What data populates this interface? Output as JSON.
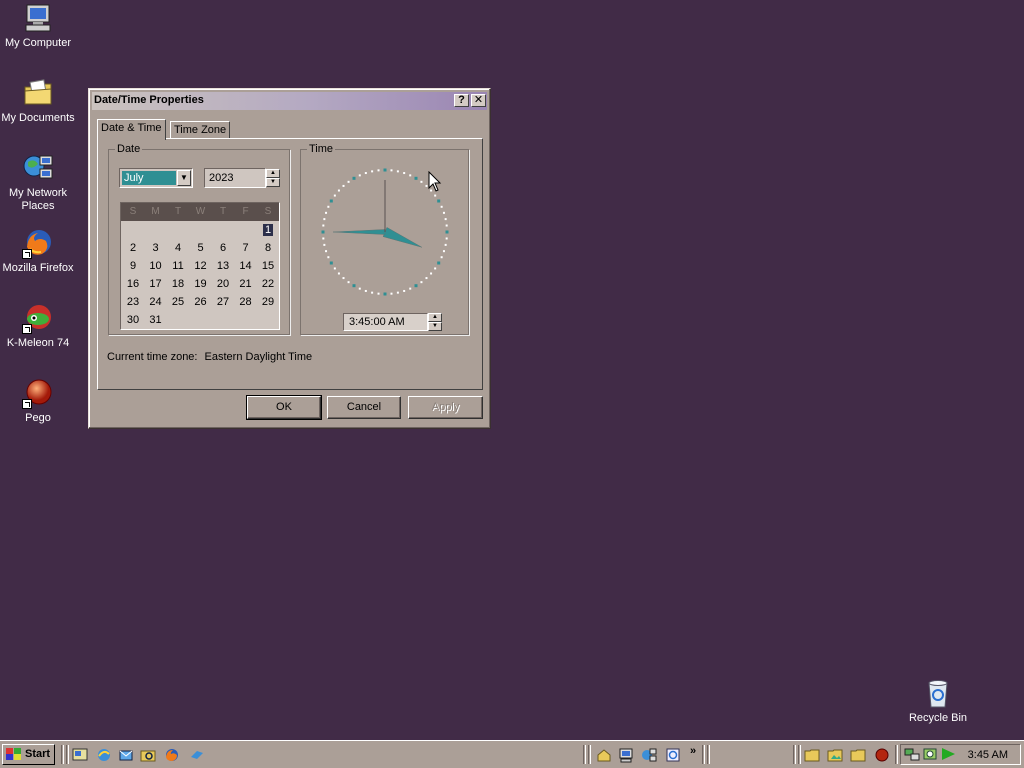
{
  "desktop": {
    "icons": [
      {
        "label": "My Computer",
        "icon": "computer-icon"
      },
      {
        "label": "My Documents",
        "icon": "folder-documents-icon"
      },
      {
        "label": "My Network Places",
        "icon": "network-places-icon"
      },
      {
        "label": "Mozilla Firefox",
        "icon": "firefox-icon"
      },
      {
        "label": "K-Meleon 74",
        "icon": "kmeleon-icon"
      },
      {
        "label": "Pego",
        "icon": "pego-icon"
      }
    ],
    "recycle_bin": {
      "label": "Recycle Bin",
      "icon": "recycle-bin-icon"
    }
  },
  "dialog": {
    "title": "Date/Time Properties",
    "help_btn": "?",
    "close_btn": "✕",
    "tabs": [
      "Date & Time",
      "Time Zone"
    ],
    "date_group": "Date",
    "month": "July",
    "year": "2023",
    "weekdays": [
      "S",
      "M",
      "T",
      "W",
      "T",
      "F",
      "S"
    ],
    "days": [
      "1",
      "2",
      "3",
      "4",
      "5",
      "6",
      "7",
      "8",
      "9",
      "10",
      "11",
      "12",
      "13",
      "14",
      "15",
      "16",
      "17",
      "18",
      "19",
      "20",
      "21",
      "22",
      "23",
      "24",
      "25",
      "26",
      "27",
      "28",
      "29",
      "30",
      "31"
    ],
    "first_weekday_index": 6,
    "selected_day": "1",
    "time_group": "Time",
    "time_value": "3:45:00 AM",
    "current_tz_label": "Current time zone:",
    "current_tz_value": "Eastern Daylight Time",
    "ok": "OK",
    "cancel": "Cancel",
    "apply": "Apply"
  },
  "clock_face": {
    "hour": 3,
    "minute": 45,
    "second": 0,
    "hand_color": "#2f8f93"
  },
  "taskbar": {
    "start": "Start",
    "quick_launch": [
      "show-desktop-icon",
      "ie-icon",
      "outlook-icon",
      "explorer-icon",
      "firefox-icon",
      "messenger-icon"
    ],
    "chevron": "»",
    "tray_icons": [
      "folder-icon",
      "image-folder-icon",
      "folder-icon",
      "pego-icon"
    ],
    "tray_sys_icons": [
      "network-icon",
      "volume-icon",
      "media-play-icon"
    ],
    "time": "3:45 AM"
  },
  "colors": {
    "desktop": "#412b47",
    "face": "#ab9f97",
    "accent": "#2f8f93"
  }
}
